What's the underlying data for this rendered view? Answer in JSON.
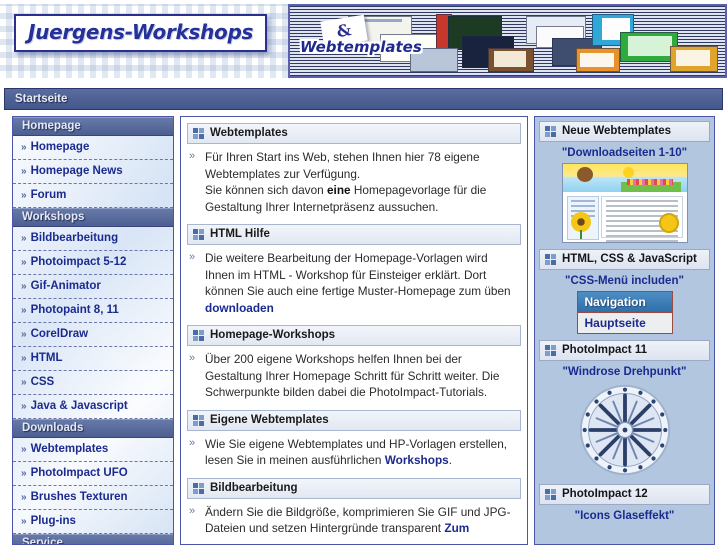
{
  "header": {
    "logo_text": "Juergens-Workshops",
    "banner_amp": "&",
    "banner_word": "Webtemplates"
  },
  "breadcrumb": {
    "label": "Startseite"
  },
  "sidebar": {
    "groups": [
      {
        "title": "Homepage",
        "items": [
          {
            "label": "Homepage"
          },
          {
            "label": "Homepage News"
          },
          {
            "label": "Forum"
          }
        ]
      },
      {
        "title": "Workshops",
        "items": [
          {
            "label": "Bildbearbeitung"
          },
          {
            "label": "Photoimpact 5-12"
          },
          {
            "label": "Gif-Animator"
          },
          {
            "label": "Photopaint 8, 11"
          },
          {
            "label": "CorelDraw"
          },
          {
            "label": "HTML"
          },
          {
            "label": "CSS"
          },
          {
            "label": "Java & Javascript"
          }
        ]
      },
      {
        "title": "Downloads",
        "items": [
          {
            "label": "Webtemplates"
          },
          {
            "label": "PhotoImpact UFO"
          },
          {
            "label": "Brushes Texturen"
          },
          {
            "label": "Plug-ins"
          }
        ]
      },
      {
        "title": "Service",
        "items": []
      }
    ],
    "bullet": "»"
  },
  "main": {
    "arrow": "»",
    "panels": [
      {
        "title": "Webtemplates",
        "lines": [
          {
            "type": "text",
            "value": "Für Ihren Start ins Web, stehen Ihnen hier 78 eigene Webtemplates zur Verfügung."
          },
          {
            "type": "break"
          },
          {
            "type": "text",
            "value": "Sie können sich davon "
          },
          {
            "type": "bold",
            "value": "eine"
          },
          {
            "type": "text",
            "value": " Homepagevorlage für die Gestaltung Ihrer Internetpräsenz aussuchen."
          }
        ]
      },
      {
        "title": "HTML Hilfe",
        "lines": [
          {
            "type": "text",
            "value": "Die weitere Bearbeitung der Homepage-Vorlagen wird Ihnen im HTML - Workshop für Einsteiger erklärt. Dort können Sie auch eine fertige Muster-Homepage zum üben "
          },
          {
            "type": "link",
            "value": "downloaden"
          }
        ]
      },
      {
        "title": "Homepage-Workshops",
        "lines": [
          {
            "type": "text",
            "value": "Über 200 eigene Workshops helfen Ihnen bei der Gestaltung Ihrer Homepage Schritt für Schritt weiter. Die Schwerpunkte bilden dabei die PhotoImpact-Tutorials."
          }
        ]
      },
      {
        "title": "Eigene Webtemplates",
        "lines": [
          {
            "type": "text",
            "value": "Wie Sie eigene Webtemplates und HP-Vorlagen erstellen, lesen Sie in meinen ausführlichen "
          },
          {
            "type": "link",
            "value": "Workshops"
          },
          {
            "type": "text",
            "value": "."
          }
        ]
      },
      {
        "title": "Bildbearbeitung",
        "lines": [
          {
            "type": "text",
            "value": "Ändern Sie die Bildgröße, komprimieren Sie GIF und JPG-Dateien und setzen Hintergründe transparent "
          },
          {
            "type": "link",
            "value": "Zum"
          }
        ]
      }
    ]
  },
  "right": {
    "panels": [
      {
        "title": "Neue Webtemplates",
        "caption": "\"Downloadseiten 1-10\"",
        "art": "template-thumb"
      },
      {
        "title": "HTML, CSS & JavaScript",
        "caption": "\"CSS-Menü includen\"",
        "art": "css-menu"
      },
      {
        "title": "PhotoImpact 11",
        "caption": "\"Windrose Drehpunkt\"",
        "art": "compass"
      },
      {
        "title": "PhotoImpact 12",
        "caption": "\"Icons Glaseffekt\"",
        "art": "none"
      }
    ],
    "css_menu": {
      "nav_label": "Navigation",
      "main_label": "Hauptseite"
    }
  },
  "colors": {
    "accent": "#1b2a8e",
    "header_bar": "#4d5f92",
    "right_bg": "#b3c6e0",
    "border": "#4c56a8"
  }
}
